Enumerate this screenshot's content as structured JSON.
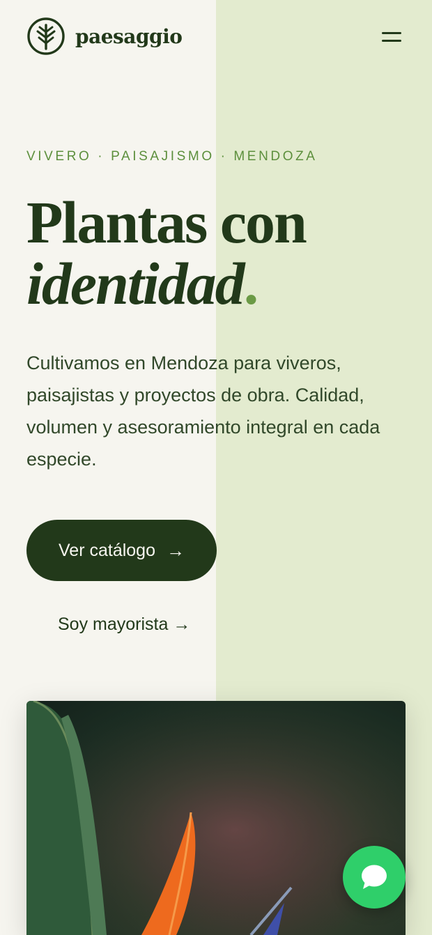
{
  "brand": {
    "name": "paesaggio",
    "logo_icon": "tree-icon"
  },
  "header": {
    "menu_icon": "hamburger-menu-icon"
  },
  "hero": {
    "eyebrow": "VIVERO · PAISAJISMO · MENDOZA",
    "headline_line1": "Plantas con",
    "headline_line2": "identidad",
    "headline_dot": ".",
    "lead": "Cultivamos en Mendoza para viveros, paisajistas y proyectos de obra. Calidad, volumen y asesoramiento integral en cada especie.",
    "primary_cta": "Ver catálogo",
    "primary_cta_icon": "→",
    "secondary_cta": "Soy mayorista →"
  },
  "chat": {
    "icon": "chat-bubble-icon"
  },
  "colors": {
    "dark_green": "#22391a",
    "accent_green": "#5c8f3c",
    "background": "#f6f5ef",
    "panel": "#e3ebcf",
    "whatsapp": "#2fcf6a"
  }
}
